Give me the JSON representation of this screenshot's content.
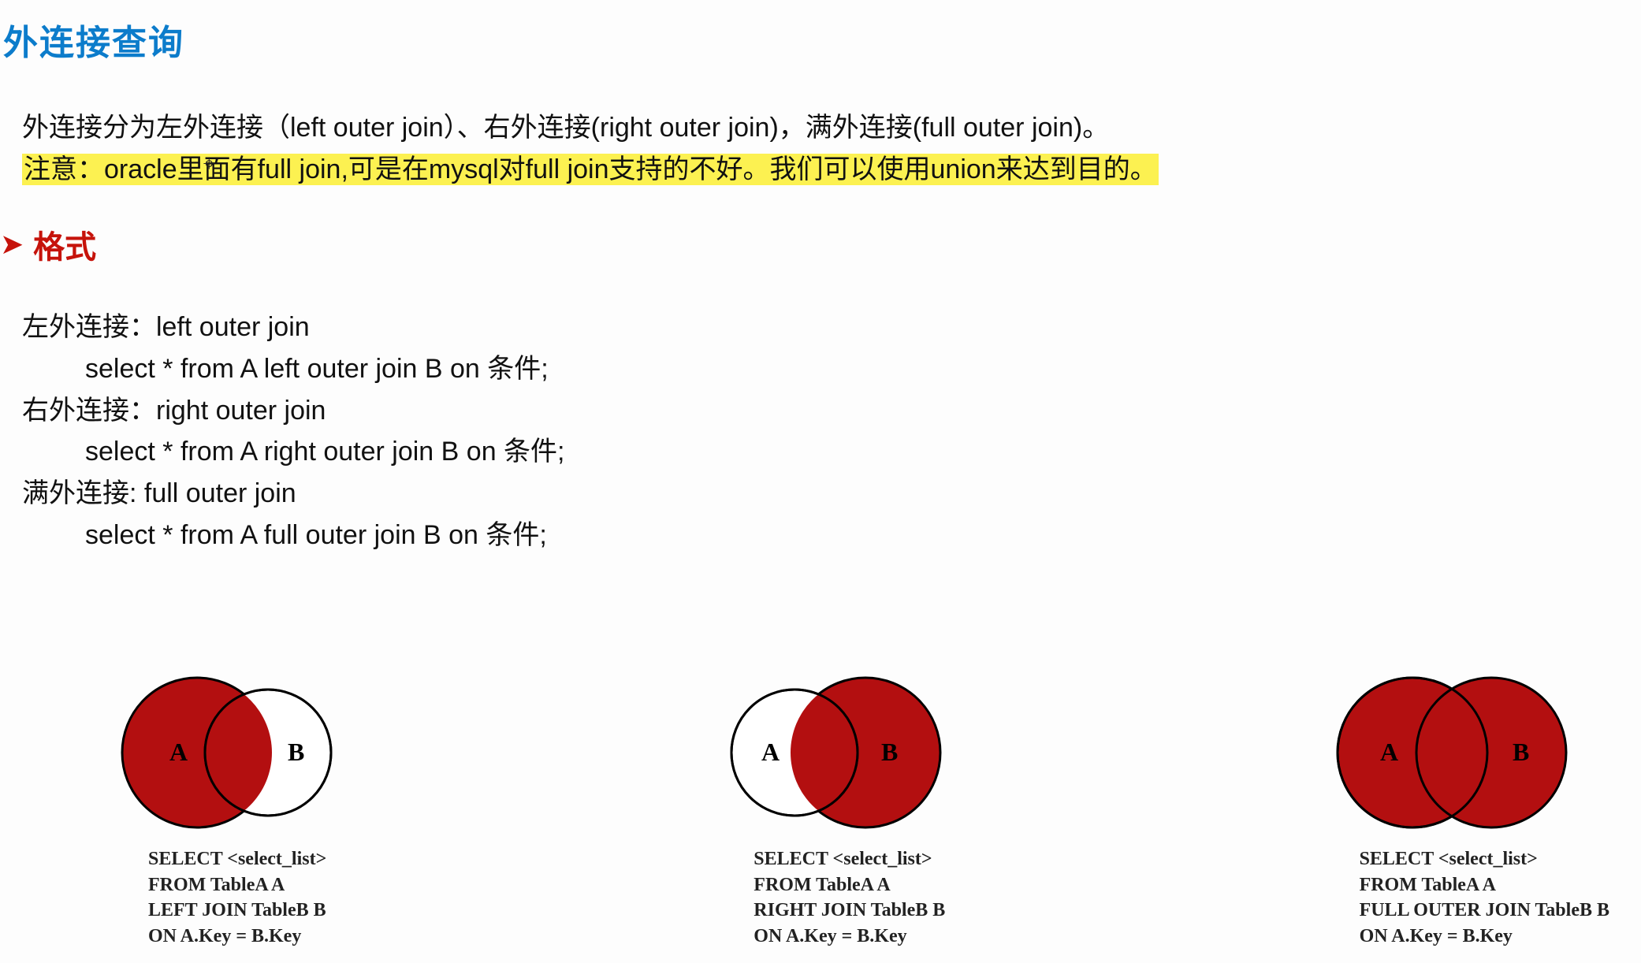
{
  "title": "外连接查询",
  "intro": {
    "line1": "外连接分为左外连接（left outer join）、右外连接(right outer join)，满外连接(full outer join)。",
    "line2_highlight": "注意：oracle里面有full join,可是在mysql对full join支持的不好。我们可以使用union来达到目的。"
  },
  "section": {
    "arrow": "➤",
    "title": "格式"
  },
  "formats": {
    "left_title": "左外连接：left outer join",
    "left_sql": "select * from A left outer join B on 条件;",
    "right_title": "右外连接：right outer join",
    "right_sql": "select * from A right outer join B on 条件;",
    "full_title": "满外连接: full outer join",
    "full_sql": "select * from A full outer join B on 条件;"
  },
  "venns": [
    {
      "label_a": "A",
      "label_b": "B",
      "sql": "SELECT <select_list>\nFROM TableA A\nLEFT JOIN TableB B\nON A.Key = B.Key"
    },
    {
      "label_a": "A",
      "label_b": "B",
      "sql": "SELECT <select_list>\nFROM TableA A\nRIGHT JOIN TableB B\nON A.Key = B.Key"
    },
    {
      "label_a": "A",
      "label_b": "B",
      "sql": "SELECT <select_list>\nFROM TableA A\nFULL OUTER JOIN TableB B\nON A.Key = B.Key"
    }
  ],
  "colors": {
    "fill": "#b30f10",
    "stroke": "#000000"
  }
}
